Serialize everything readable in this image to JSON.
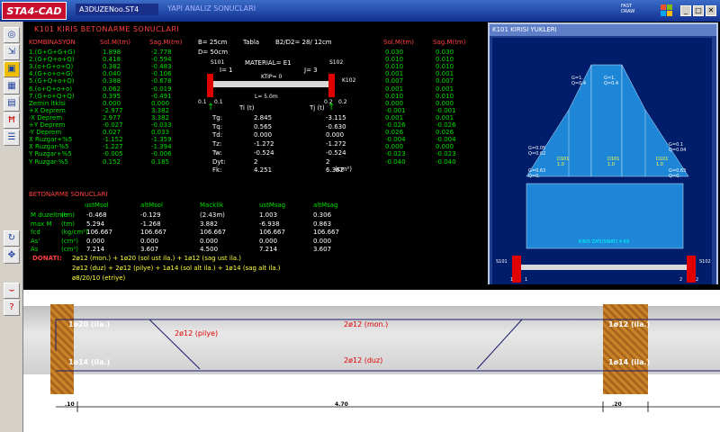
{
  "titlebar": {
    "logo": "STA4-CAD",
    "filename": "A3DUZENoo.ST4",
    "title": "YAPI ANALIZ SONUCLARI",
    "fast": "FAST",
    "draw": "DRAW",
    "btn_min": "_",
    "btn_max": "□",
    "btn_close": "✕"
  },
  "report": {
    "title": "K101 KIRIS BETONARME SONUCLARI",
    "kombinasyon_header": "KOMBINASYON",
    "col_sol": "Sol.M(tm)",
    "col_sag": "Sag.M(tm)",
    "col_sol2": "Sol.M(tm)",
    "col_sag2": "Sag.M(tm)",
    "combos": [
      {
        "name": "1.(G+G+G+G)",
        "a": "1.898",
        "b": "-2.778",
        "c": "0.030",
        "d": "0.030"
      },
      {
        "name": "2.(G+Q+o+Q)",
        "a": "0.418",
        "b": "-0.594",
        "c": "0.010",
        "d": "0.010"
      },
      {
        "name": "3.(o+G+o+Q)",
        "a": "0.382",
        "b": "-0.483",
        "c": "0.010",
        "d": "0.010"
      },
      {
        "name": "4.(G+o+o+G)",
        "a": "0.040",
        "b": "-0.106",
        "c": "0.001",
        "d": "0.001"
      },
      {
        "name": "5.(G+Q+o+Q)",
        "a": "0.388",
        "b": "-0.678",
        "c": "0.007",
        "d": "0.007"
      },
      {
        "name": "6.(o+Q+o+o)",
        "a": "0.062",
        "b": "-0.019",
        "c": "0.001",
        "d": "0.001"
      },
      {
        "name": "7.(G+o+Q+Q)",
        "a": "0.395",
        "b": "-0.491",
        "c": "0.010",
        "d": "0.010"
      },
      {
        "name": "Zemin itkisi",
        "a": "0.000",
        "b": "0.000",
        "c": "0.000",
        "d": "0.000"
      },
      {
        "name": "+X Deprem",
        "a": "-2.977",
        "b": "3.382",
        "c": "-0.001",
        "d": "-0.001"
      },
      {
        "name": "-X Deprem",
        "a": "2.977",
        "b": "3.382",
        "c": "0.001",
        "d": "0.001"
      },
      {
        "name": "+Y Deprem",
        "a": "-0.027",
        "b": "-0.033",
        "c": "-0.026",
        "d": "-0.026"
      },
      {
        "name": "-Y Deprem",
        "a": "0.027",
        "b": "0.033",
        "c": "0.026",
        "d": "0.026"
      },
      {
        "name": "X Ruzgar+%5",
        "a": "-1.152",
        "b": "-1.359",
        "c": "-0.004",
        "d": "-0.004"
      },
      {
        "name": "X Ruzgar-%5",
        "a": "-1.227",
        "b": "-1.394",
        "c": "0.000",
        "d": "0.000"
      },
      {
        "name": "Y Ruzgar+%5",
        "a": "-0.005",
        "b": "-0.006",
        "c": "-0.023",
        "d": "-0.023"
      },
      {
        "name": "Y Ruzgar-%5",
        "a": "0.152",
        "b": "0.185",
        "c": "-0.040",
        "d": "-0.040"
      }
    ],
    "geom": {
      "b": "B= 25cm",
      "d": "D= 50cm",
      "tabla": "Tabla",
      "b2d2": "B2/D2= 28/ 12cm",
      "material": "MATERIAL= E1",
      "ktip": "KTIP= 0",
      "s101": "S101",
      "s102": "S102",
      "k102": "K102",
      "i": "I= 1",
      "j": "J= 3",
      "l": "L= 5.0m",
      "d1": "0.1",
      "d2": "0.1",
      "d3": "0.2",
      "d4": "0.2"
    },
    "forces": {
      "ti": "Ti (t)",
      "tj": "Tj (t)",
      "rows": [
        {
          "k": "Tg:",
          "a": "2.845",
          "b": "-3.115"
        },
        {
          "k": "Tq:",
          "a": "0.565",
          "b": "-0.630"
        },
        {
          "k": "Td:",
          "a": "0.000",
          "b": "0.000"
        },
        {
          "k": "Tz:",
          "a": "-1.272",
          "b": "-1.272"
        },
        {
          "k": "Tw:",
          "a": "-0.524",
          "b": "-0.524"
        },
        {
          "k": "Dyt:",
          "a": "2",
          "b": "2"
        },
        {
          "k": "Fk:",
          "a": "4.251",
          "b": "6.362"
        }
      ],
      "unit": "(cm²)"
    },
    "beton_title": "BETONARME SONUCLARI",
    "bh": {
      "c1": "ustMsol",
      "c2": "altMsol",
      "c3": "Macklik",
      "c4": "ustMsag",
      "c5": "altMsag"
    },
    "brows": [
      {
        "k": "M duzeltme",
        "u": "(tm)",
        "v": [
          "-0.468",
          "-0.129",
          "(2.43m)",
          "1.003",
          "0.306"
        ]
      },
      {
        "k": "max M",
        "u": "(tm)",
        "v": [
          "5.294",
          "-1.268",
          "3.882",
          "-6.938",
          "0.863"
        ]
      },
      {
        "k": "fcd",
        "u": "(kg/cm²)",
        "v": [
          "106.667",
          "106.667",
          "106.667",
          "106.667",
          "106.667"
        ]
      },
      {
        "k": "As'",
        "u": "(cm²)",
        "v": [
          "0.000",
          "0.000",
          "0.000",
          "0.000",
          "0.000"
        ]
      },
      {
        "k": "As",
        "u": "(cm²)",
        "v": [
          "7.214",
          "3.607",
          "4.500",
          "7.214",
          "3.607"
        ]
      }
    ],
    "donati_label": "DONATI:",
    "donati": [
      "2ø12 (mon.) + 1ø20 (sol ust ila.) + 1ø12 (sag ust ila.)",
      "2ø12 (duz) + 2ø12 (pilye) + 1ø14 (sol alt ila.) + 1ø14 (sag alt ila.)",
      "ø8/20/10 (etriye)"
    ]
  },
  "loads": {
    "title": "K101 KIRISI YUKLERI",
    "g1": "G=1.",
    "g1b": "Q=0.4",
    "g2": "G=1.",
    "g2b": "Q=0.4",
    "gl": "G=0.05",
    "glb": "Q=0.02",
    "gr": "G=0.1",
    "grb": "Q=0.04",
    "d1": "D101",
    "d1b": "1.0",
    "d2": "D101",
    "d2b": "1.0",
    "d3": "D101",
    "d3b": "1.0",
    "gl2": "G=0.63",
    "gl2b": "Q=0.",
    "gr2": "G=0.63",
    "gr2b": "Q=0.",
    "kiris": "KIRIS ZATI(SWAT) 4.69",
    "s101": "S101",
    "s102": "S102",
    "n1": "1",
    "n1b": "1",
    "n2": "2",
    "n2b": "2"
  },
  "beam": {
    "top_left": "1ø20 (ila.)",
    "top_right": "1ø12 (ila.)",
    "bot_left": "1ø14 (ila.)",
    "bot_right": "1ø14 (ila.)",
    "pilye": "2ø12 (pilye)",
    "mon": "2ø12 (mon.)",
    "duz": "2ø12 (duz)",
    "dim_left": ".10",
    "dim_mid": "4.70",
    "dim_right": ".20"
  },
  "toolbar": [
    "zoom-icon",
    "dimension-icon",
    "beam-icon",
    "grid-icon",
    "section-icon",
    "rebar-icon",
    "load-icon",
    "refresh-icon",
    "move-icon",
    "curve-icon",
    "help-icon"
  ]
}
